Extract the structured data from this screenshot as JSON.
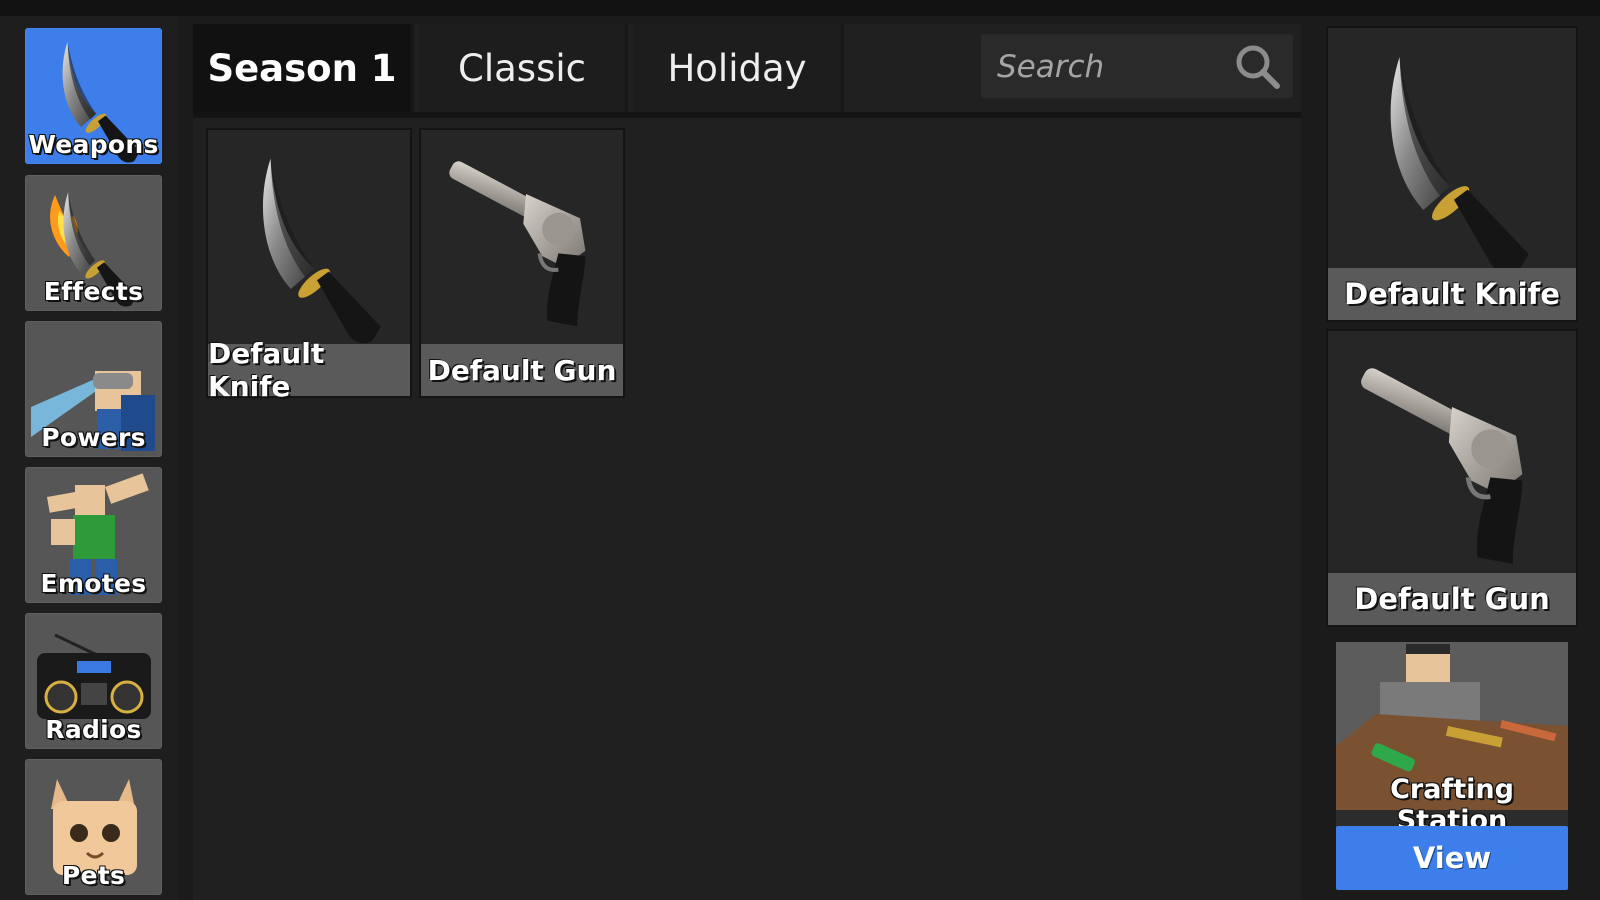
{
  "sidebar": {
    "items": [
      {
        "label": "Weapons",
        "icon": "knife-icon",
        "active": true
      },
      {
        "label": "Effects",
        "icon": "flame-knife-icon"
      },
      {
        "label": "Powers",
        "icon": "laser-eyes-icon"
      },
      {
        "label": "Emotes",
        "icon": "dab-emote-icon"
      },
      {
        "label": "Radios",
        "icon": "boombox-icon"
      },
      {
        "label": "Pets",
        "icon": "cat-pet-icon"
      }
    ]
  },
  "tabs": [
    {
      "label": "Season 1",
      "active": true
    },
    {
      "label": "Classic"
    },
    {
      "label": "Holiday"
    }
  ],
  "search": {
    "placeholder": "Search",
    "value": ""
  },
  "items": [
    {
      "name": "Default Knife",
      "icon": "knife-icon"
    },
    {
      "name": "Default Gun",
      "icon": "revolver-icon"
    }
  ],
  "equipped": {
    "knife": {
      "name": "Default Knife",
      "icon": "knife-icon"
    },
    "gun": {
      "name": "Default Gun",
      "icon": "revolver-icon"
    }
  },
  "crafting": {
    "title": "Crafting Station",
    "button": "View"
  },
  "colors": {
    "accent": "#3d7eea",
    "tile": "#565656",
    "panel": "#202020",
    "label_bar": "#5a5a5a"
  }
}
